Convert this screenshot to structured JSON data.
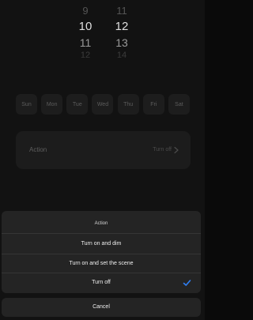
{
  "time_picker": {
    "hours": [
      "9",
      "10",
      "11",
      "12"
    ],
    "minutes": [
      "11",
      "12",
      "13",
      "14"
    ]
  },
  "days": [
    "Sun",
    "Mon",
    "Tue",
    "Wed",
    "Thu",
    "Fri",
    "Sat"
  ],
  "action_row": {
    "label": "Action",
    "value": "Turn off"
  },
  "action_sheet": {
    "title": "Action",
    "options": [
      {
        "label": "Turn on and dim",
        "selected": false
      },
      {
        "label": "Turn on and set the scene",
        "selected": false
      },
      {
        "label": "Turn off",
        "selected": true
      }
    ],
    "cancel_label": "Cancel"
  },
  "colors": {
    "accent": "#2f7ff5",
    "sheet_background": "#242424"
  },
  "icons": {
    "selected": "check-icon",
    "row_arrow": "chevron-right-icon"
  }
}
